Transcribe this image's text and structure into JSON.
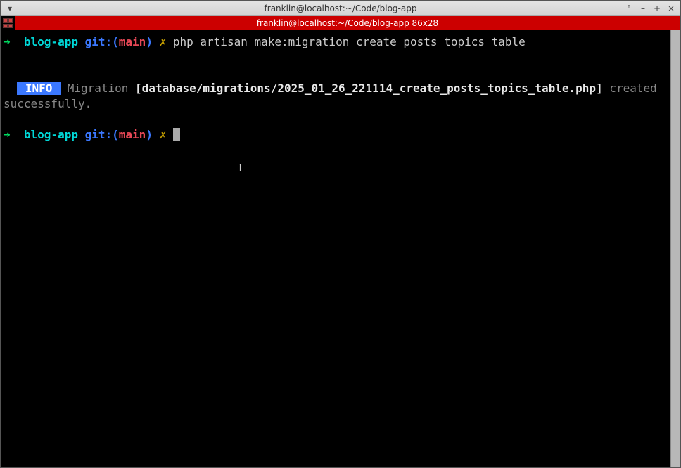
{
  "window": {
    "title": "franklin@localhost:~/Code/blog-app"
  },
  "titlebar_controls": {
    "menu": "▾",
    "up": "ꜛ",
    "min": "–",
    "max": "+",
    "close": "×"
  },
  "tab": {
    "title": "franklin@localhost:~/Code/blog-app 86x28"
  },
  "terminal": {
    "arrow": "➜",
    "folder": "blog-app",
    "git_label": "git:(",
    "branch": "main",
    "git_close": ")",
    "dirty": "✗",
    "command": "php artisan make:migration create_posts_topics_table",
    "info_badge": " INFO ",
    "migration_label": " Migration ",
    "migration_path": "[database/migrations/2025_01_26_221114_create_posts_topics_table.php]",
    "created_text": " created successfully."
  }
}
